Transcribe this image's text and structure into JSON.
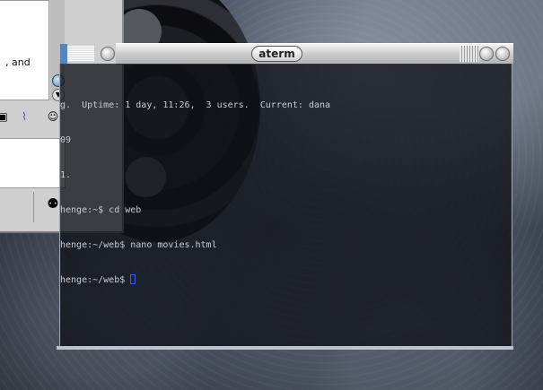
{
  "left_window": {
    "visible_text": ", and"
  },
  "aterm": {
    "title": "aterm",
    "lines": [
      "g.  Uptime: 1 day, 11:26,  3 users.  Current: dana",
      "09",
      "1.",
      "henge:~$ cd web",
      "henge:~/web$ nano movies.html",
      "henge:~/web$ "
    ]
  }
}
